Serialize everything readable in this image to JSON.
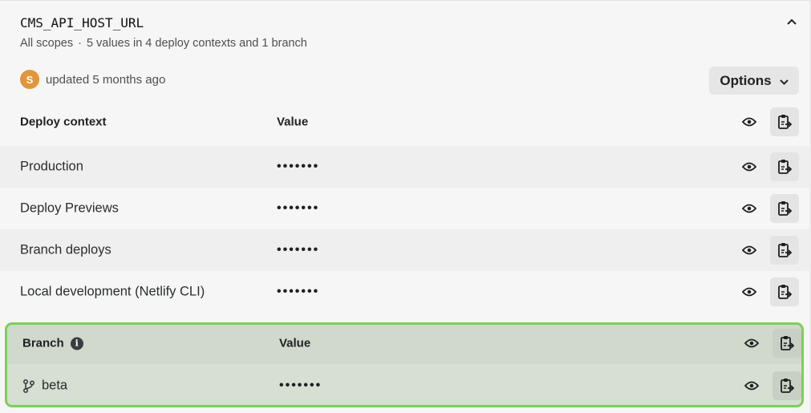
{
  "variable": {
    "name": "CMS_API_HOST_URL",
    "scope": "All scopes",
    "separator": "·",
    "summary": "5 values in 4 deploy contexts and 1 branch"
  },
  "author": {
    "initial": "S",
    "updated": "updated 5 months ago"
  },
  "options_label": "Options",
  "contexts_table": {
    "header": {
      "col1": "Deploy context",
      "col2": "Value"
    },
    "rows": [
      {
        "label": "Production",
        "value": "•••••••"
      },
      {
        "label": "Deploy Previews",
        "value": "•••••••"
      },
      {
        "label": "Branch deploys",
        "value": "•••••••"
      },
      {
        "label": "Local development (Netlify CLI)",
        "value": "•••••••"
      }
    ]
  },
  "branch_table": {
    "header": {
      "col1": "Branch",
      "col2": "Value"
    },
    "rows": [
      {
        "label": "beta",
        "value": "•••••••"
      }
    ]
  },
  "icons": {
    "collapse": "chevron-up-icon",
    "options": "chevron-down-icon",
    "reveal": "eye-icon",
    "copy": "clipboard-copy-icon",
    "info": "info-icon",
    "branch": "git-branch-icon"
  },
  "colors": {
    "avatar": "#e0963a",
    "highlight_border": "#7bcf58",
    "highlight_bg": "#d3ddcf"
  }
}
